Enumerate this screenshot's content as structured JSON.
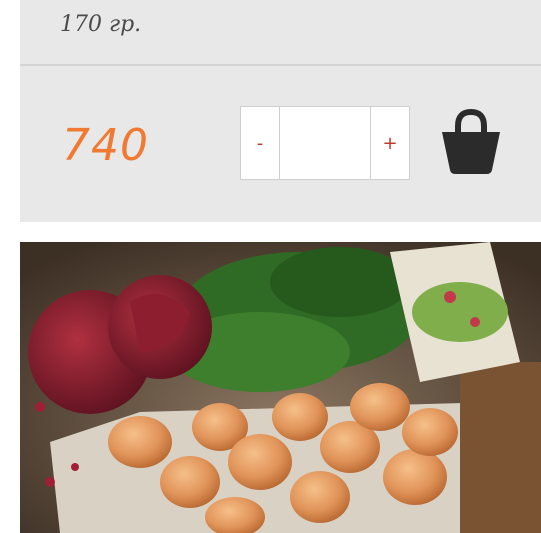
{
  "product": {
    "weight": "170 гр.",
    "price": "740"
  },
  "stepper": {
    "minus_label": "-",
    "plus_label": "+",
    "quantity_value": ""
  },
  "icons": {
    "cart": "shopping-basket-icon"
  },
  "colors": {
    "price": "#f07a32",
    "stepper_symbols": "#c0392b",
    "card_background": "#e8e8e8",
    "basket": "#2b2b2b"
  },
  "image": {
    "subject": "food-photo"
  }
}
